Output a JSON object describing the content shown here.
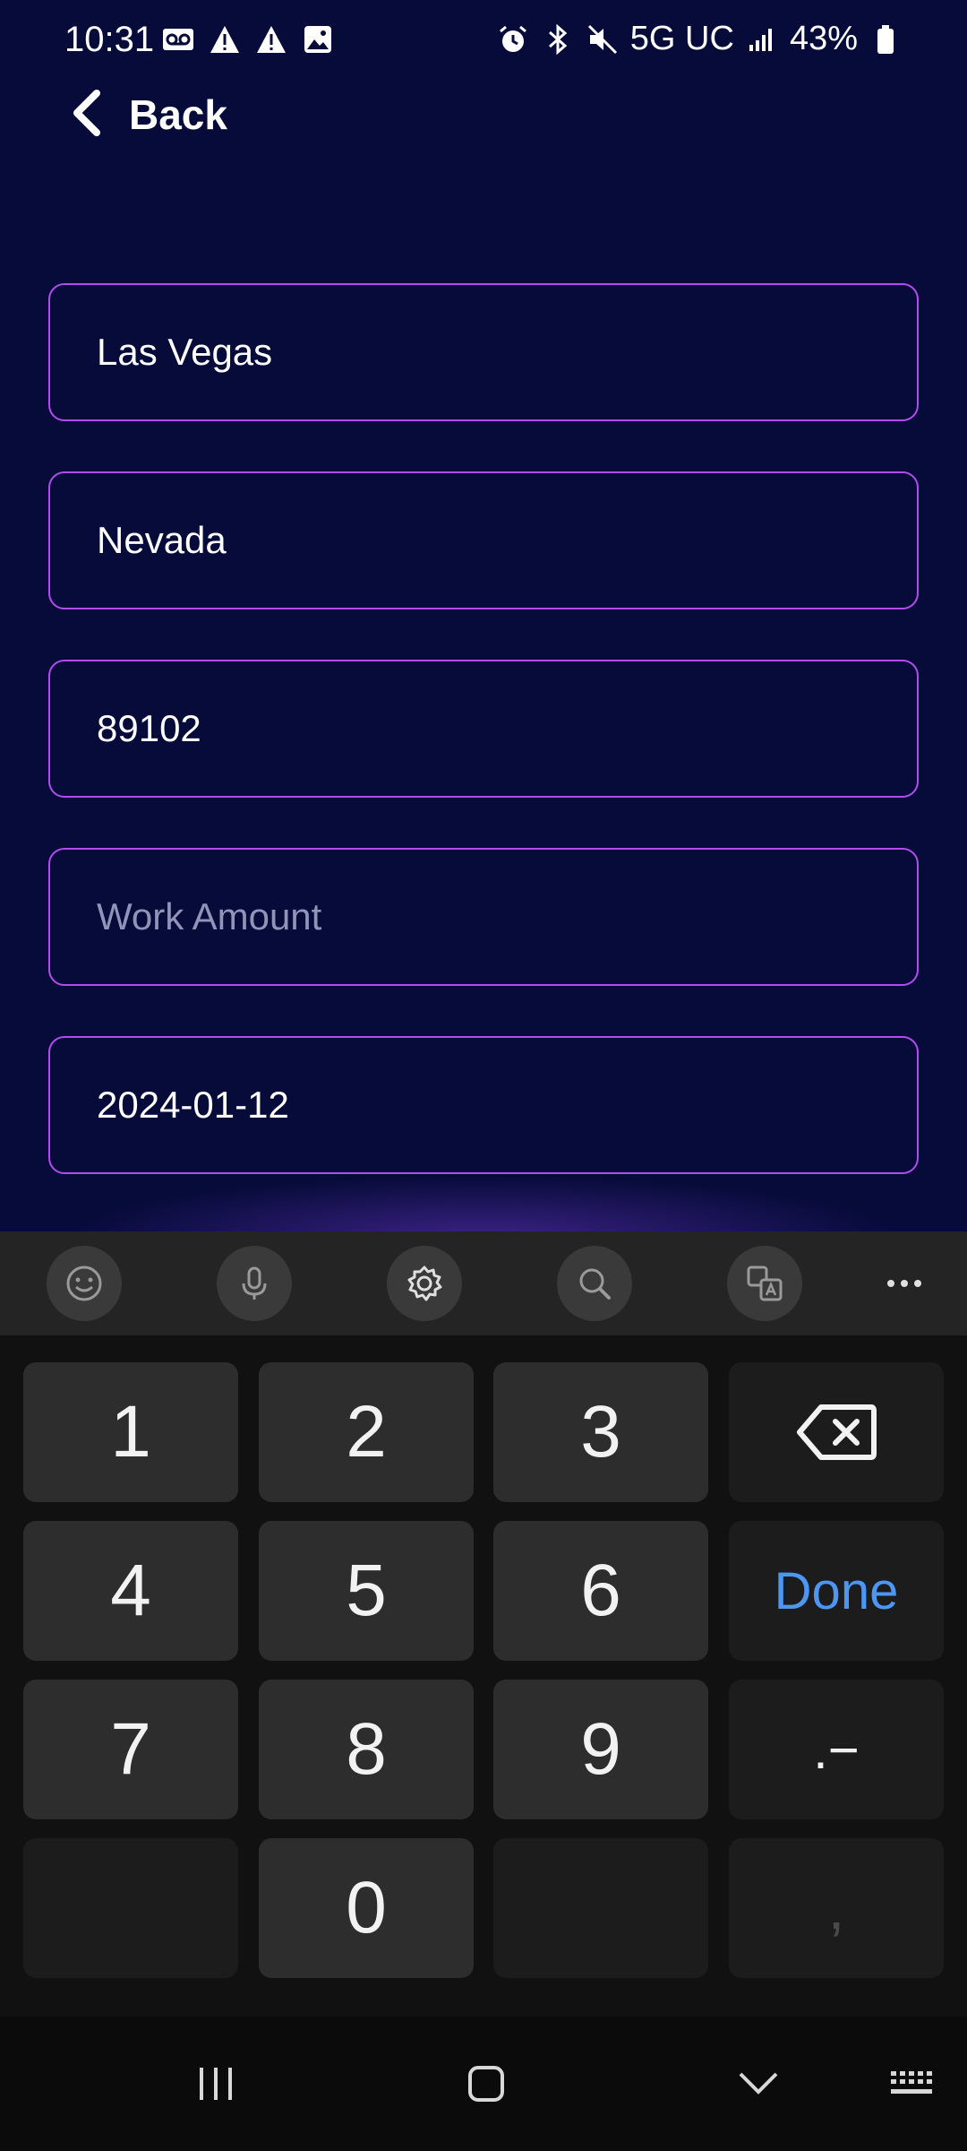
{
  "status_bar": {
    "time": "10:31",
    "left_icons": [
      "voicemail-icon",
      "warning-icon",
      "warning-icon",
      "image-icon"
    ],
    "right_icons": [
      "alarm-icon",
      "bluetooth-icon",
      "mute-icon"
    ],
    "network": "5G UC",
    "battery": "43%"
  },
  "header": {
    "back_label": "Back"
  },
  "form": {
    "city": "Las Vegas",
    "state": "Nevada",
    "zip": "89102",
    "work_amount_placeholder": "Work Amount",
    "date": "2024-01-12"
  },
  "keyboard_toolbar": {
    "buttons": [
      "emoji-icon",
      "microphone-icon",
      "settings-icon",
      "search-icon",
      "translate-icon",
      "more-icon"
    ]
  },
  "keypad": {
    "keys": [
      "1",
      "2",
      "3",
      "4",
      "5",
      "6",
      "7",
      "8",
      "9",
      "0"
    ],
    "done_label": "Done",
    "symbol_label": ".−",
    "comma_label": ","
  },
  "nav_bar": {
    "buttons": [
      "recents-icon",
      "home-icon",
      "back-down-icon",
      "keyboard-icon"
    ]
  },
  "colors": {
    "background": "#070b3a",
    "field_border": "#b24cf0",
    "done_text": "#4d97f2",
    "key_bg": "#2d2d2d"
  }
}
